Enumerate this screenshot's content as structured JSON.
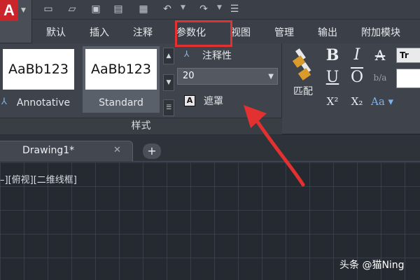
{
  "app": {
    "logo_letter": "A",
    "accent_color": "#c9252b"
  },
  "quick_access": {
    "icons": [
      "new-file-icon",
      "open-file-icon",
      "save-icon",
      "save-as-icon",
      "print-icon",
      "undo-icon",
      "redo-icon",
      "customize-icon"
    ]
  },
  "menu": {
    "tabs": [
      {
        "label": "默认"
      },
      {
        "label": "插入"
      },
      {
        "label": "注释"
      },
      {
        "label": "参数化"
      },
      {
        "label": "视图"
      },
      {
        "label": "管理"
      },
      {
        "label": "输出"
      },
      {
        "label": "附加模块"
      }
    ]
  },
  "style_panel": {
    "cards": [
      {
        "preview": "AaBb123",
        "label": "Annotative"
      },
      {
        "preview": "AaBb123",
        "label": "Standard"
      }
    ],
    "annotative_label": "注释性",
    "text_height_value": "20",
    "mask_label": "遮罩",
    "mask_icon_letter": "A",
    "title": "样式"
  },
  "format_panel": {
    "match_label": "匹配",
    "bold": "B",
    "italic": "I",
    "strike": "A",
    "underline": "U",
    "overline": "O",
    "stack": "b/a",
    "superscript": "X²",
    "subscript": "X₂",
    "change_case": "Aa ▾",
    "font_sample": "Tr",
    "highlight_color": "#e33030"
  },
  "document": {
    "tab_label": "Drawing1*",
    "close_glyph": "✕",
    "new_tab_glyph": "+"
  },
  "canvas": {
    "viewport_label": "–][俯视][二维线框]"
  },
  "watermark": "头条 @猫Ning"
}
